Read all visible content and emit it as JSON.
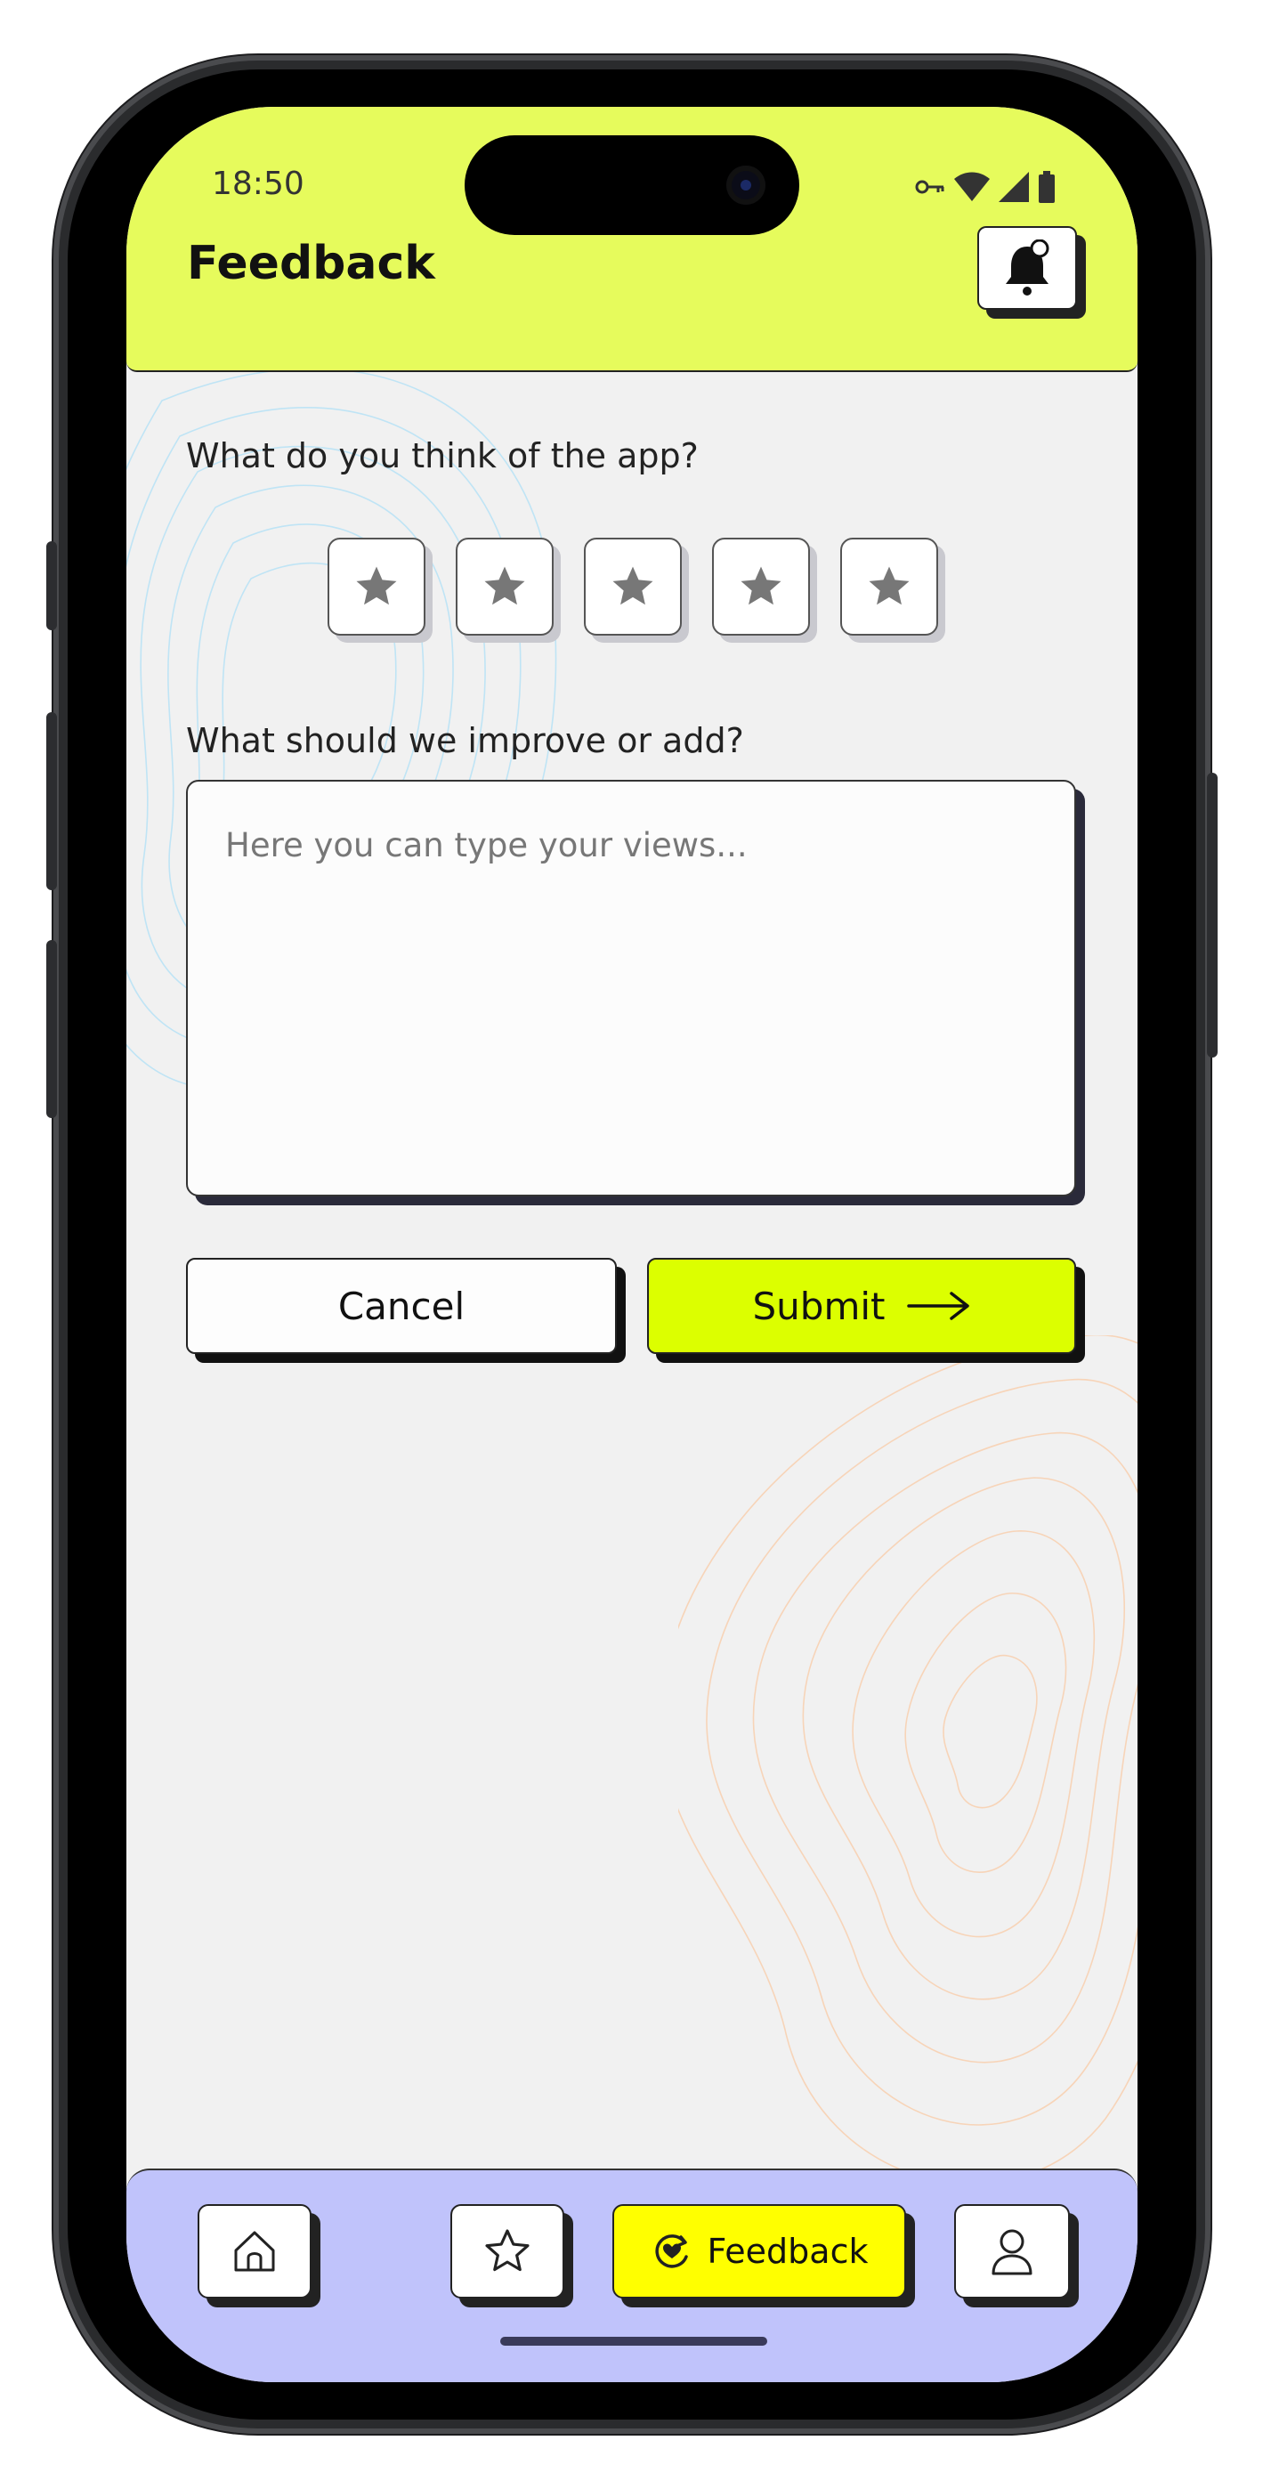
{
  "status_bar": {
    "time": "18:50",
    "icons": [
      "vpn-key-icon",
      "wifi-icon",
      "signal-icon",
      "battery-icon"
    ]
  },
  "header": {
    "title": "Feedback",
    "bell_icon": "bell-icon",
    "background": "#e6fb5c"
  },
  "rating": {
    "question": "What do you think of the app?",
    "stars_total": 5,
    "stars_selected": 0
  },
  "improve": {
    "question": "What should we improve or add?",
    "placeholder": "Here you can type your views...",
    "value": ""
  },
  "actions": {
    "cancel_label": "Cancel",
    "submit_label": "Submit",
    "submit_icon": "arrow-right-icon",
    "submit_color": "#dcff00"
  },
  "bottom_nav": {
    "background": "#c0c3fb",
    "items": [
      {
        "icon": "home-icon",
        "label": ""
      },
      {
        "icon": "star-icon",
        "label": ""
      },
      {
        "icon": "feedback-icon",
        "label": "Feedback",
        "active": true
      },
      {
        "icon": "profile-icon",
        "label": ""
      }
    ]
  }
}
